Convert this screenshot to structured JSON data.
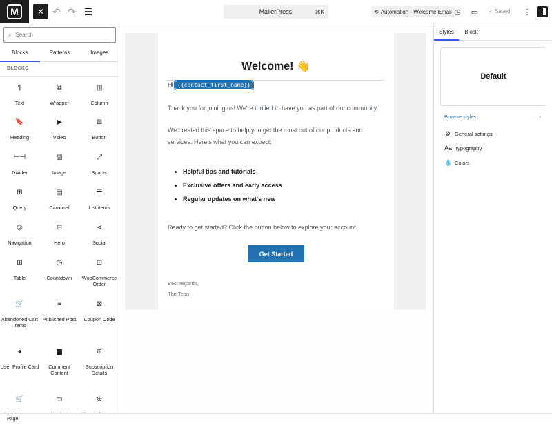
{
  "topbar": {
    "logo_letter": "M",
    "close_label": "✕",
    "command": {
      "title": "MailerPress",
      "shortcut": "⌘K"
    },
    "automation_label": "Automation - Welcome Email",
    "saved_label": "Saved"
  },
  "inserter": {
    "search_placeholder": "Search",
    "tabs": [
      "Blocks",
      "Patterns",
      "Images"
    ],
    "section_label": "BLOCKS",
    "blocks": [
      {
        "label": "Text",
        "icon": "¶"
      },
      {
        "label": "Wrapper",
        "icon": "⧉"
      },
      {
        "label": "Column",
        "icon": "▥"
      },
      {
        "label": "Heading",
        "icon": "🔖"
      },
      {
        "label": "Video",
        "icon": "▶"
      },
      {
        "label": "Button",
        "icon": "⊟"
      },
      {
        "label": "Divider",
        "icon": "⊢⊣"
      },
      {
        "label": "Image",
        "icon": "▨"
      },
      {
        "label": "Spacer",
        "icon": "⤢"
      },
      {
        "label": "Query",
        "icon": "⊞"
      },
      {
        "label": "Carousel",
        "icon": "▤"
      },
      {
        "label": "List items",
        "icon": "☰"
      },
      {
        "label": "Navigation",
        "icon": "◎"
      },
      {
        "label": "Hero",
        "icon": "⊟"
      },
      {
        "label": "Social",
        "icon": "⋖"
      },
      {
        "label": "Table",
        "icon": "⊞"
      },
      {
        "label": "Countdown",
        "icon": "◷"
      },
      {
        "label": "WooCommerce Order",
        "icon": "⊡"
      },
      {
        "label": "Abandoned Cart Items",
        "icon": "🛒"
      },
      {
        "label": "Published Post",
        "icon": "≡"
      },
      {
        "label": "Coupon Code",
        "icon": "⊠"
      },
      {
        "label": "User Profile Card",
        "icon": "●"
      },
      {
        "label": "Comment Content",
        "icon": "▆"
      },
      {
        "label": "Subscription Details",
        "icon": "⊕"
      },
      {
        "label": "Cart Recovery",
        "icon": "🛒"
      },
      {
        "label": "Product Showcase",
        "icon": "▭"
      },
      {
        "label": "View in browser",
        "icon": "⊕"
      }
    ]
  },
  "email": {
    "title": "Welcome! 👋",
    "greeting": "Hi",
    "merge_tag": "{{contact_first_name}}",
    "greeting_end": ",",
    "p1": "Thank you for joining us! We're thrilled to have you as part of our community.",
    "p2a": "We created this space to help you get the most out of our products and",
    "p2b": "services. Here's what you can expect:",
    "bullets": [
      "Helpful tips and tutorials",
      "Exclusive offers and early access",
      "Regular updates on what's new"
    ],
    "p3": "Ready to get started? Click the button below to explore your account.",
    "cta": "Get Started",
    "sign1": "Best regards,",
    "sign2": "The Team"
  },
  "sidebar": {
    "tabs": [
      "Styles",
      "Block"
    ],
    "style_card": "Default",
    "browse": "Browse styles",
    "items": [
      {
        "label": "General settings",
        "icon": "⚙"
      },
      {
        "label": "Typography",
        "icon": "Aa"
      },
      {
        "label": "Colors",
        "icon": "💧"
      }
    ]
  },
  "footer": {
    "label": "Page"
  }
}
